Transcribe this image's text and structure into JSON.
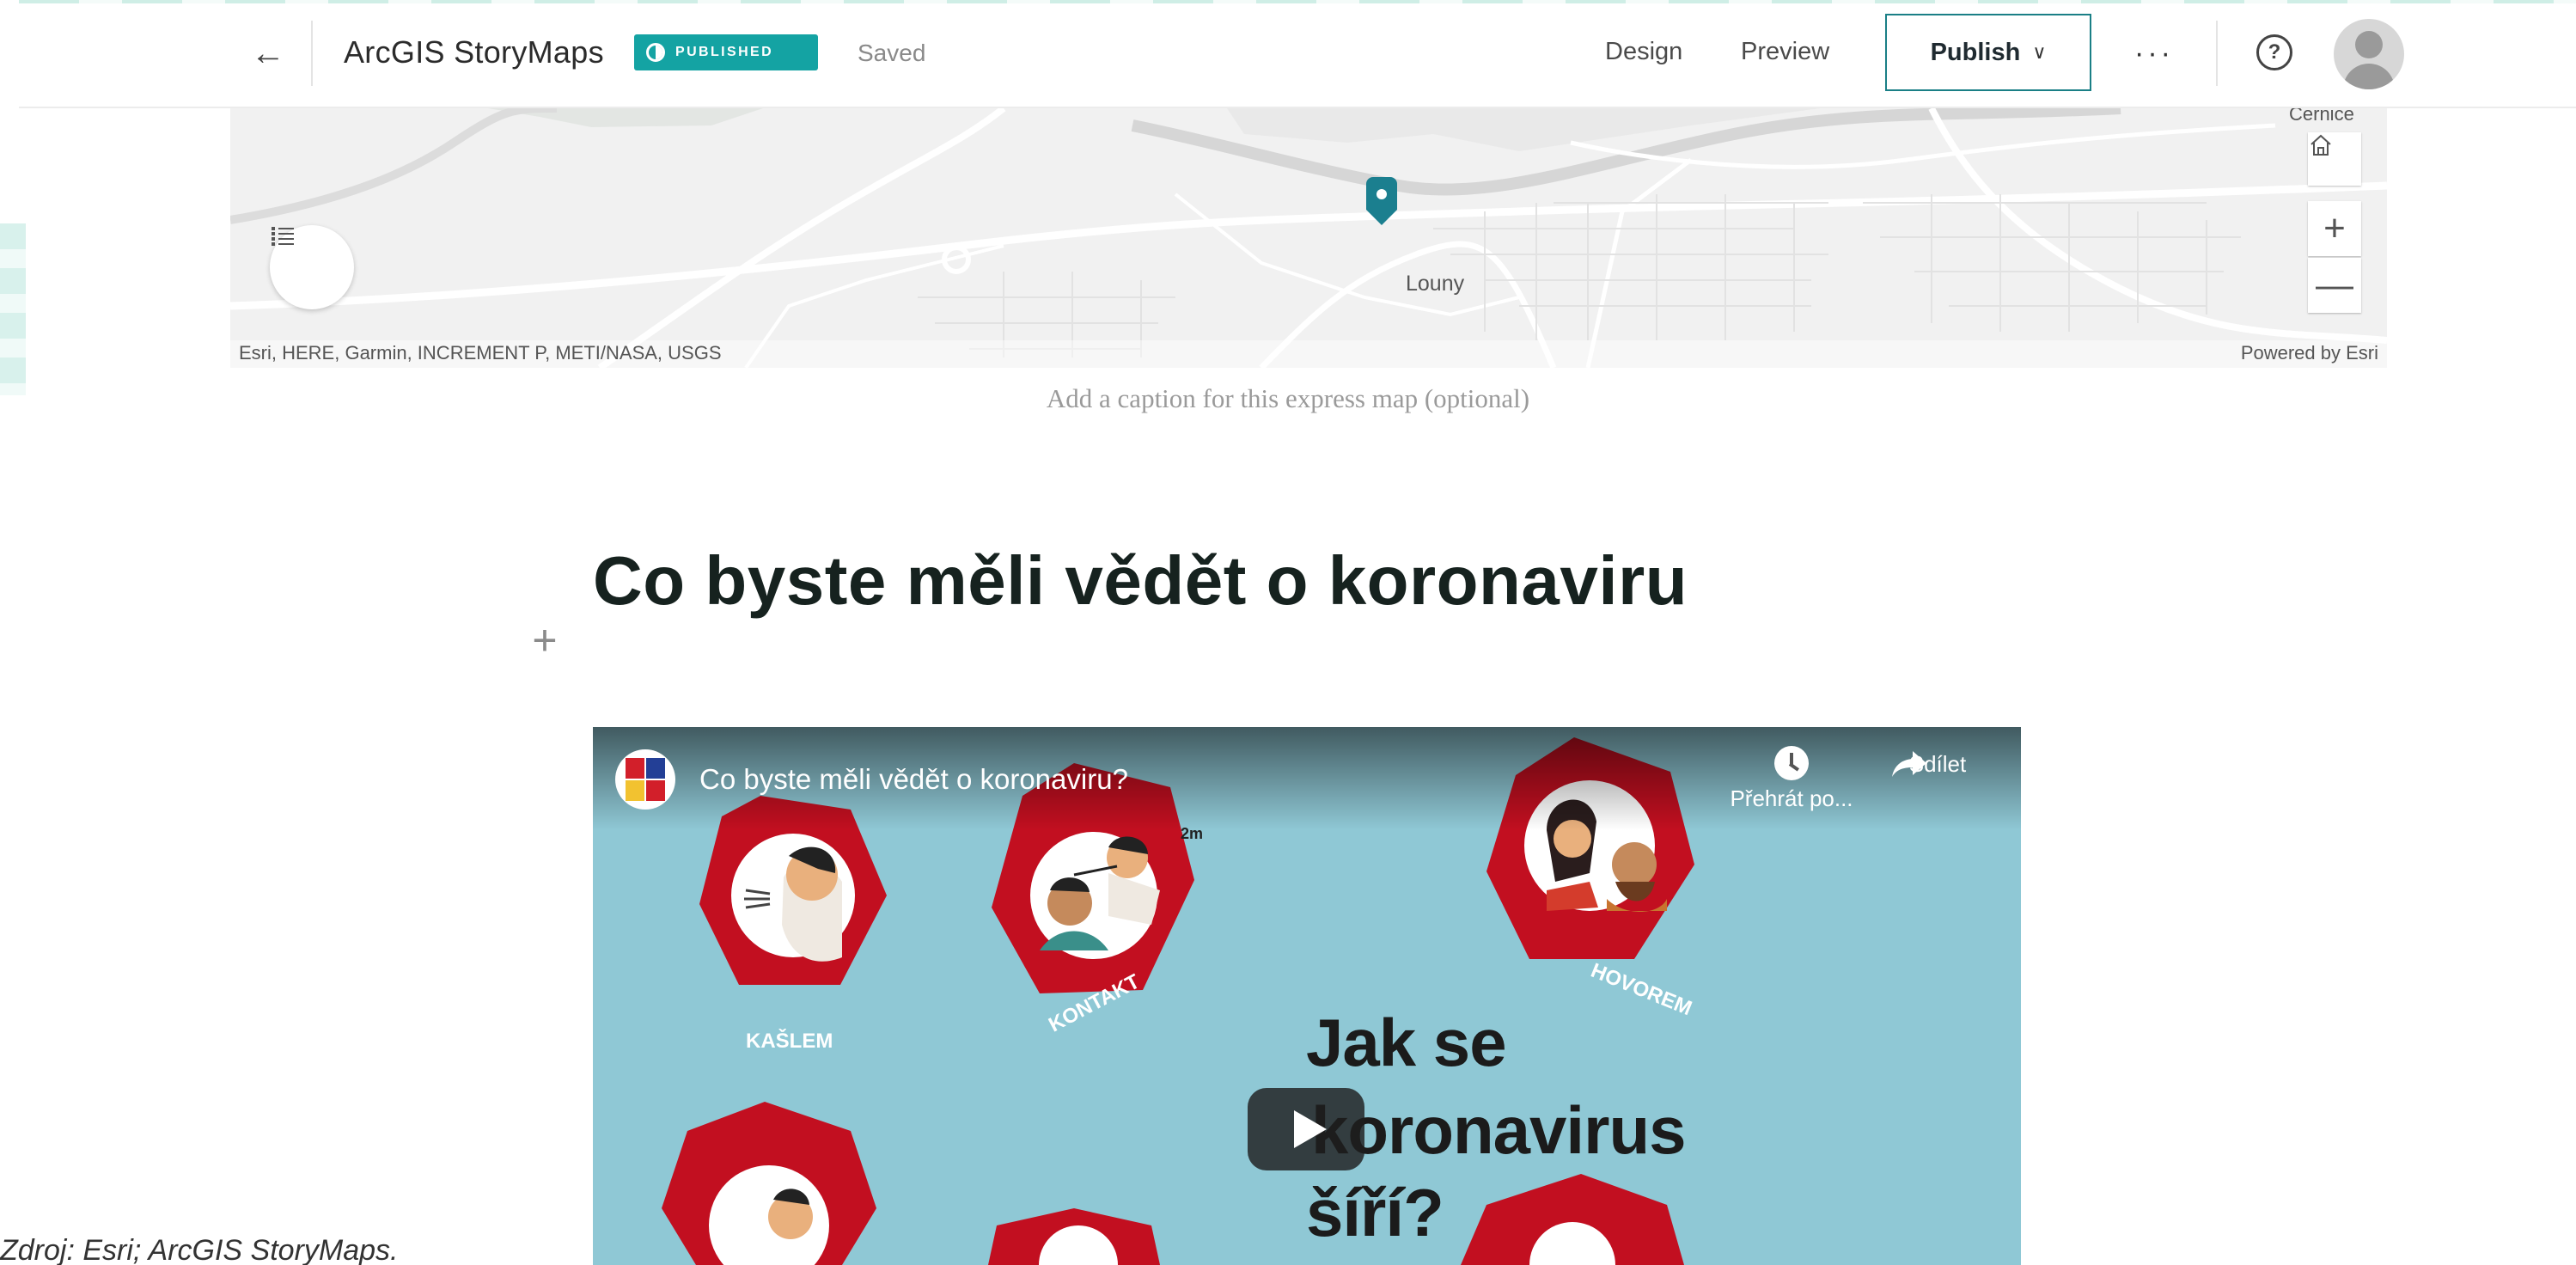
{
  "header": {
    "back_icon": "arrow-left-icon",
    "app_title": "ArcGIS StoryMaps",
    "status_badge": "PUBLISHED",
    "save_status": "Saved",
    "nav": {
      "design": "Design",
      "preview": "Preview"
    },
    "publish_label": "Publish",
    "more_icon": "ellipsis-icon",
    "help_icon": "question-icon",
    "accent_color": "#14a3a3"
  },
  "map": {
    "place_labels": {
      "louny": "Louny",
      "cernice": "Cernice"
    },
    "attribution": "Esri, HERE, Garmin, INCREMENT P, METI/NASA, USGS",
    "powered_by": "Powered by Esri",
    "controls": {
      "home_icon": "home-icon",
      "zoom_in": "+",
      "zoom_out": "—",
      "legend_icon": "list-icon"
    },
    "marker_color": "#1b7f8f"
  },
  "caption_placeholder": "Add a caption for this express map (optional)",
  "block": {
    "add_icon": "+",
    "heading": "Co byste měli vědět o koronaviru"
  },
  "video": {
    "title": "Co byste měli vědět o koronaviru?",
    "watch_later": "Přehrát po...",
    "share": "Sdílet",
    "labels": {
      "cough": "KAŠLEM",
      "contact": "KONTAKT",
      "speech": "HOVOREM",
      "distance": "2m"
    },
    "headline": [
      "Jak se",
      "koronavirus",
      "šíří?"
    ],
    "play_icon": "play-icon"
  },
  "source_note": "Zdroj: Esri; ArcGIS StoryMaps."
}
